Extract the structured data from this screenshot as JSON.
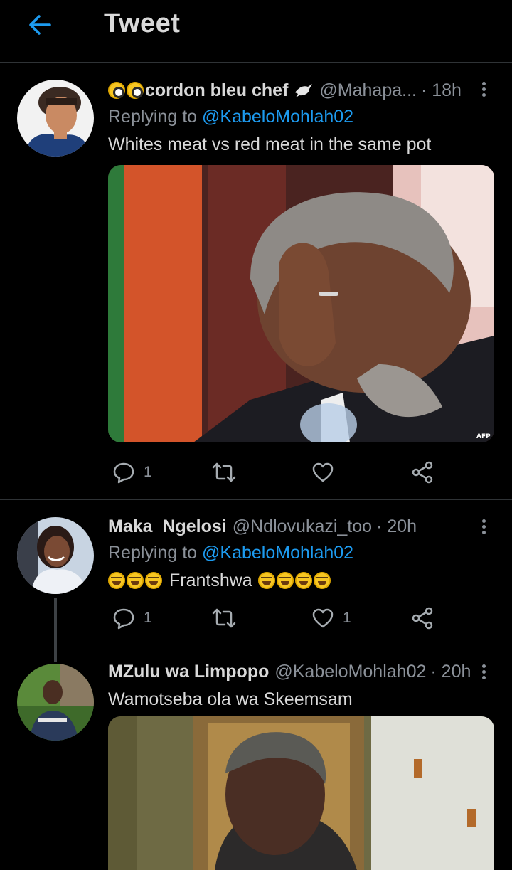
{
  "header": {
    "title": "Tweet"
  },
  "tweets": [
    {
      "display_name": "cordon bleu chef",
      "handle": "@Mahapa...",
      "time": "· 18h",
      "replying_prefix": "Replying to ",
      "replying_to": "@KabeloMohlah02",
      "text": "Whites  meat vs red meat in the same pot",
      "media_watermark": "AFP",
      "reply_count": "1",
      "retweet_count": "",
      "like_count": ""
    },
    {
      "display_name": "Maka_Ngelosi",
      "handle": "@Ndlovukazi_too",
      "time": "· 20h",
      "replying_prefix": "Replying to ",
      "replying_to": "@KabeloMohlah02",
      "text": "Frantshwa",
      "reply_count": "1",
      "retweet_count": "",
      "like_count": "1"
    },
    {
      "display_name": "MZulu wa Limpopo",
      "handle": "@KabeloMohlah02",
      "time": "· 20h",
      "text": "Wamotseba ola wa Skeemsam"
    }
  ],
  "colors": {
    "accent": "#1d9bf0",
    "background": "#000000",
    "muted": "#8b9199"
  }
}
